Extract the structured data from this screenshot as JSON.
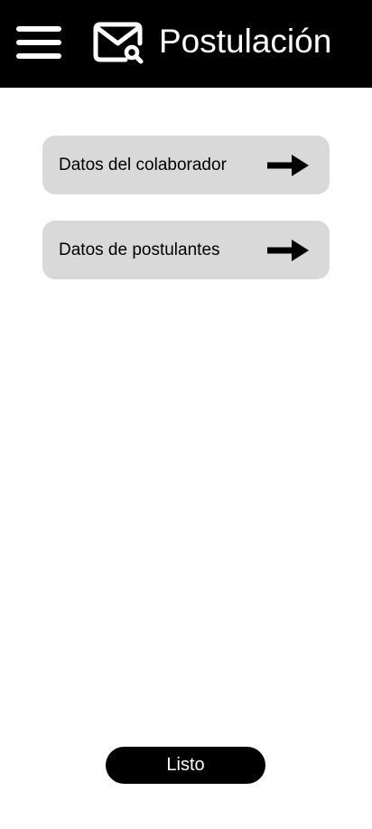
{
  "header": {
    "title": "Postulación",
    "menu_icon": "hamburger-menu-icon",
    "title_icon": "mail-search-icon",
    "background": "#000000",
    "foreground": "#ffffff"
  },
  "menu": {
    "items": [
      {
        "label": "Datos del colaborador",
        "icon": "arrow-right-icon"
      },
      {
        "label": "Datos de postulantes",
        "icon": "arrow-right-icon"
      }
    ],
    "card_color": "#d9d9d9"
  },
  "footer": {
    "done_label": "Listo"
  }
}
